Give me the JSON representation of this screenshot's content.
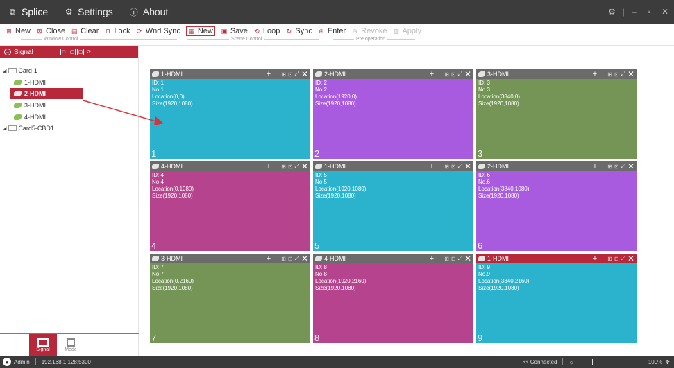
{
  "titlebar": {
    "tabs": [
      {
        "label": "Splice",
        "icon": "splice-icon",
        "active": true
      },
      {
        "label": "Settings",
        "icon": "settings-icon",
        "active": false
      },
      {
        "label": "About",
        "icon": "info-icon",
        "active": false
      }
    ],
    "controls": {
      "gear": "gear-icon",
      "minimize": "minimize-icon",
      "restore": "restore-icon",
      "close": "close-icon"
    }
  },
  "toolbar": {
    "window_new": "New",
    "window_close": "Close",
    "window_clear": "Clear",
    "window_lock": "Lock",
    "window_sync": "Wnd Sync",
    "scene_new": "New",
    "scene_save": "Save",
    "scene_loop": "Loop",
    "scene_sync": "Sync",
    "pre_enter": "Enter",
    "pre_revoke": "Revoke",
    "pre_apply": "Apply",
    "group_window": "Window Control",
    "group_scene": "Scene Control",
    "group_pre": "Pre operation"
  },
  "signal_panel": {
    "title": "Signal",
    "tree": [
      {
        "label": "Card-1",
        "children": [
          "1-HDMI",
          "2-HDMI",
          "3-HDMI",
          "4-HDMI"
        ],
        "selected": "2-HDMI"
      },
      {
        "label": "Card5-CBD1",
        "children": []
      }
    ]
  },
  "modes": [
    {
      "label": "Signal",
      "active": true
    },
    {
      "label": "Mode",
      "active": false
    }
  ],
  "windows": [
    {
      "title": "1-HDMI",
      "id": "ID: 1",
      "no": "No.1",
      "loc": "Location(0,0)",
      "size": "Size(1920,1080)",
      "num": "1",
      "color": "#2bb3cd",
      "head": "gray"
    },
    {
      "title": "2-HDMI",
      "id": "ID: 2",
      "no": "No.2",
      "loc": "Location(1920,0)",
      "size": "Size(1920,1080)",
      "num": "2",
      "color": "#a95be0",
      "head": "gray"
    },
    {
      "title": "3-HDMI",
      "id": "ID: 3",
      "no": "No.3",
      "loc": "Location(3840,0)",
      "size": "Size(1920,1080)",
      "num": "3",
      "color": "#749556",
      "head": "gray"
    },
    {
      "title": "4-HDMI",
      "id": "ID: 4",
      "no": "No.4",
      "loc": "Location(0,1080)",
      "size": "Size(1920,1080)",
      "num": "4",
      "color": "#b6438d",
      "head": "gray"
    },
    {
      "title": "1-HDMI",
      "id": "ID: 5",
      "no": "No.5",
      "loc": "Location(1920,1080)",
      "size": "Size(1920,1080)",
      "num": "5",
      "color": "#2bb3cd",
      "head": "gray"
    },
    {
      "title": "2-HDMI",
      "id": "ID: 6",
      "no": "No.6",
      "loc": "Location(3840,1080)",
      "size": "Size(1920,1080)",
      "num": "6",
      "color": "#a95be0",
      "head": "gray"
    },
    {
      "title": "3-HDMI",
      "id": "ID: 7",
      "no": "No.7",
      "loc": "Location(0,2160)",
      "size": "Size(1920,1080)",
      "num": "7",
      "color": "#749556",
      "head": "gray"
    },
    {
      "title": "4-HDMI",
      "id": "ID: 8",
      "no": "No.8",
      "loc": "Location(1920,2160)",
      "size": "Size(1920,1080)",
      "num": "8",
      "color": "#b6438d",
      "head": "gray"
    },
    {
      "title": "1-HDMI",
      "id": "ID: 9",
      "no": "No.9",
      "loc": "Location(3840,2160)",
      "size": "Size(1920,1080)",
      "num": "9",
      "color": "#2bb3cd",
      "head": "red"
    }
  ],
  "statusbar": {
    "user": "Admin",
    "address": "192.168.1.128:5300",
    "connection": "Connected",
    "zoom": "100%"
  },
  "colors": {
    "accent": "#b7283b",
    "titlebar": "#3c3c3c",
    "statusbar": "#3a3a3a"
  }
}
